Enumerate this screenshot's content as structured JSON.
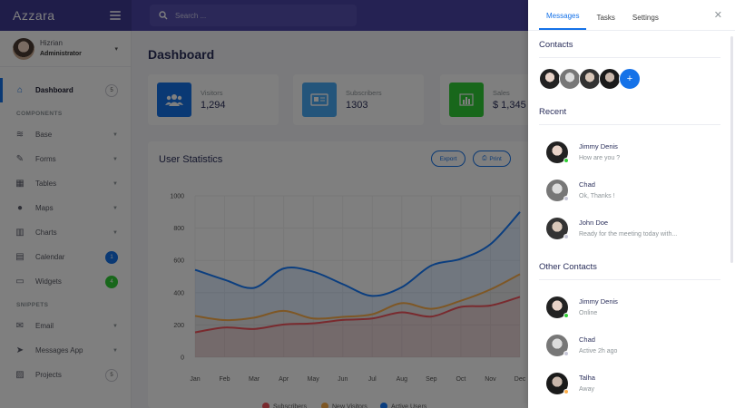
{
  "app": {
    "logo": "Azzara"
  },
  "search": {
    "placeholder": "Search ..."
  },
  "user": {
    "name": "Hizrian",
    "role": "Administrator"
  },
  "sidebar": {
    "dashboard": {
      "label": "Dashboard",
      "badge": "5"
    },
    "components_title": "COMPONENTS",
    "components": [
      {
        "label": "Base"
      },
      {
        "label": "Forms"
      },
      {
        "label": "Tables"
      },
      {
        "label": "Maps"
      },
      {
        "label": "Charts"
      },
      {
        "label": "Calendar",
        "badge": "1"
      },
      {
        "label": "Widgets",
        "badge": "4"
      }
    ],
    "snippets_title": "SNIPPETS",
    "snippets": [
      {
        "label": "Email"
      },
      {
        "label": "Messages App"
      },
      {
        "label": "Projects",
        "badge": "5"
      }
    ]
  },
  "main": {
    "title": "Dashboard",
    "stats": [
      {
        "label": "Visitors",
        "value": "1,294"
      },
      {
        "label": "Subscribers",
        "value": "1303"
      },
      {
        "label": "Sales",
        "value": "$ 1,345"
      }
    ],
    "chart_title": "User Statistics",
    "export_label": "Export",
    "print_label": "Print"
  },
  "chart_data": {
    "type": "area",
    "categories": [
      "Jan",
      "Feb",
      "Mar",
      "Apr",
      "May",
      "Jun",
      "Jul",
      "Aug",
      "Sep",
      "Oct",
      "Nov",
      "Dec"
    ],
    "ylim": [
      0,
      1000
    ],
    "yticks": [
      "0",
      "200",
      "400",
      "600",
      "800",
      "1000"
    ],
    "series": [
      {
        "name": "Subscribers",
        "color": "#f3545d",
        "values": [
          154,
          184,
          175,
          203,
          210,
          231,
          240,
          278,
          252,
          312,
          320,
          374
        ]
      },
      {
        "name": "New Visitors",
        "color": "#fdaf4b",
        "values": [
          256,
          230,
          245,
          287,
          240,
          250,
          266,
          335,
          300,
          350,
          420,
          515
        ]
      },
      {
        "name": "Active Users",
        "color": "#177dff",
        "values": [
          542,
          480,
          430,
          550,
          530,
          453,
          380,
          434,
          568,
          610,
          700,
          900
        ]
      }
    ]
  },
  "quick": {
    "tabs": [
      "Messages",
      "Tasks",
      "Settings"
    ],
    "close": "✕",
    "contacts_title": "Contacts",
    "add_label": "+",
    "recent_title": "Recent",
    "recent": [
      {
        "name": "Jimmy Denis",
        "sub": "How are you ?",
        "status": "#31ce36"
      },
      {
        "name": "Chad",
        "sub": "Ok, Thanks !",
        "status": "#c6c6d6"
      },
      {
        "name": "John Doe",
        "sub": "Ready for the meeting today with...",
        "status": "#c6c6d6"
      }
    ],
    "other_title": "Other Contacts",
    "other": [
      {
        "name": "Jimmy Denis",
        "sub": "Online",
        "status": "#31ce36"
      },
      {
        "name": "Chad",
        "sub": "Active 2h ago",
        "status": "#c6c6d6"
      },
      {
        "name": "Talha",
        "sub": "Away",
        "status": "#fdaf4b"
      }
    ]
  }
}
